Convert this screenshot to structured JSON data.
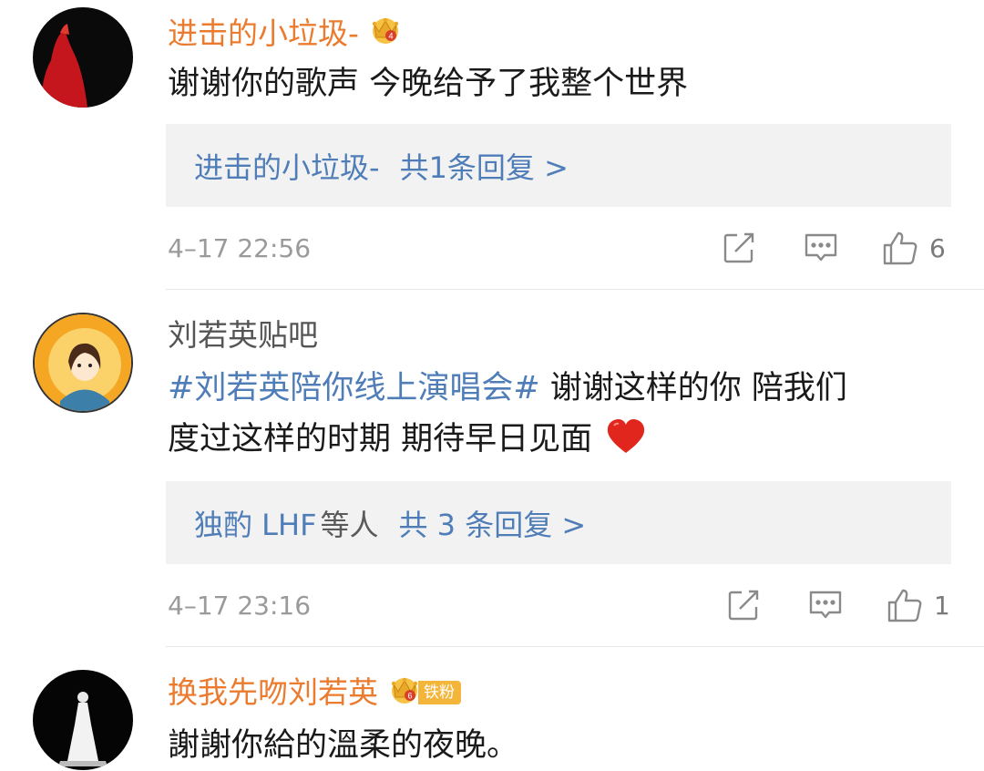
{
  "comments": [
    {
      "username": "进击的小垃圾-",
      "text": "谢谢你的歌声 今晚给予了我整个世界",
      "reply": {
        "who": "进击的小垃圾-",
        "suffix": "",
        "count_text": "共1条回复 >"
      },
      "time": "4–17 22:56",
      "likes": "6"
    },
    {
      "username": "刘若英贴吧",
      "hashtag": "#刘若英陪你线上演唱会#",
      "text_line1_rest": " 谢谢这样的你 陪我们",
      "text_line2": "度过这样的时期 期待早日见面 ",
      "emoji": "❤️",
      "reply": {
        "who": "独酌 LHF",
        "suffix": "等人",
        "count_text": "共 3 条回复 >"
      },
      "time": "4–17 23:16",
      "likes": "1"
    },
    {
      "username": "换我先吻刘若英",
      "badge_text": "铁粉",
      "text": "謝謝你給的溫柔的夜晚。"
    }
  ],
  "icons": {
    "crown_icon": "crown-vip-icon",
    "share": "share-icon",
    "comment": "comment-icon",
    "like": "thumb-up-icon"
  },
  "colors": {
    "username_vip": "#eb7c2f",
    "link_blue": "#4f7db8",
    "meta_gray": "#9a9a9a",
    "reply_bg": "#f2f2f2"
  }
}
